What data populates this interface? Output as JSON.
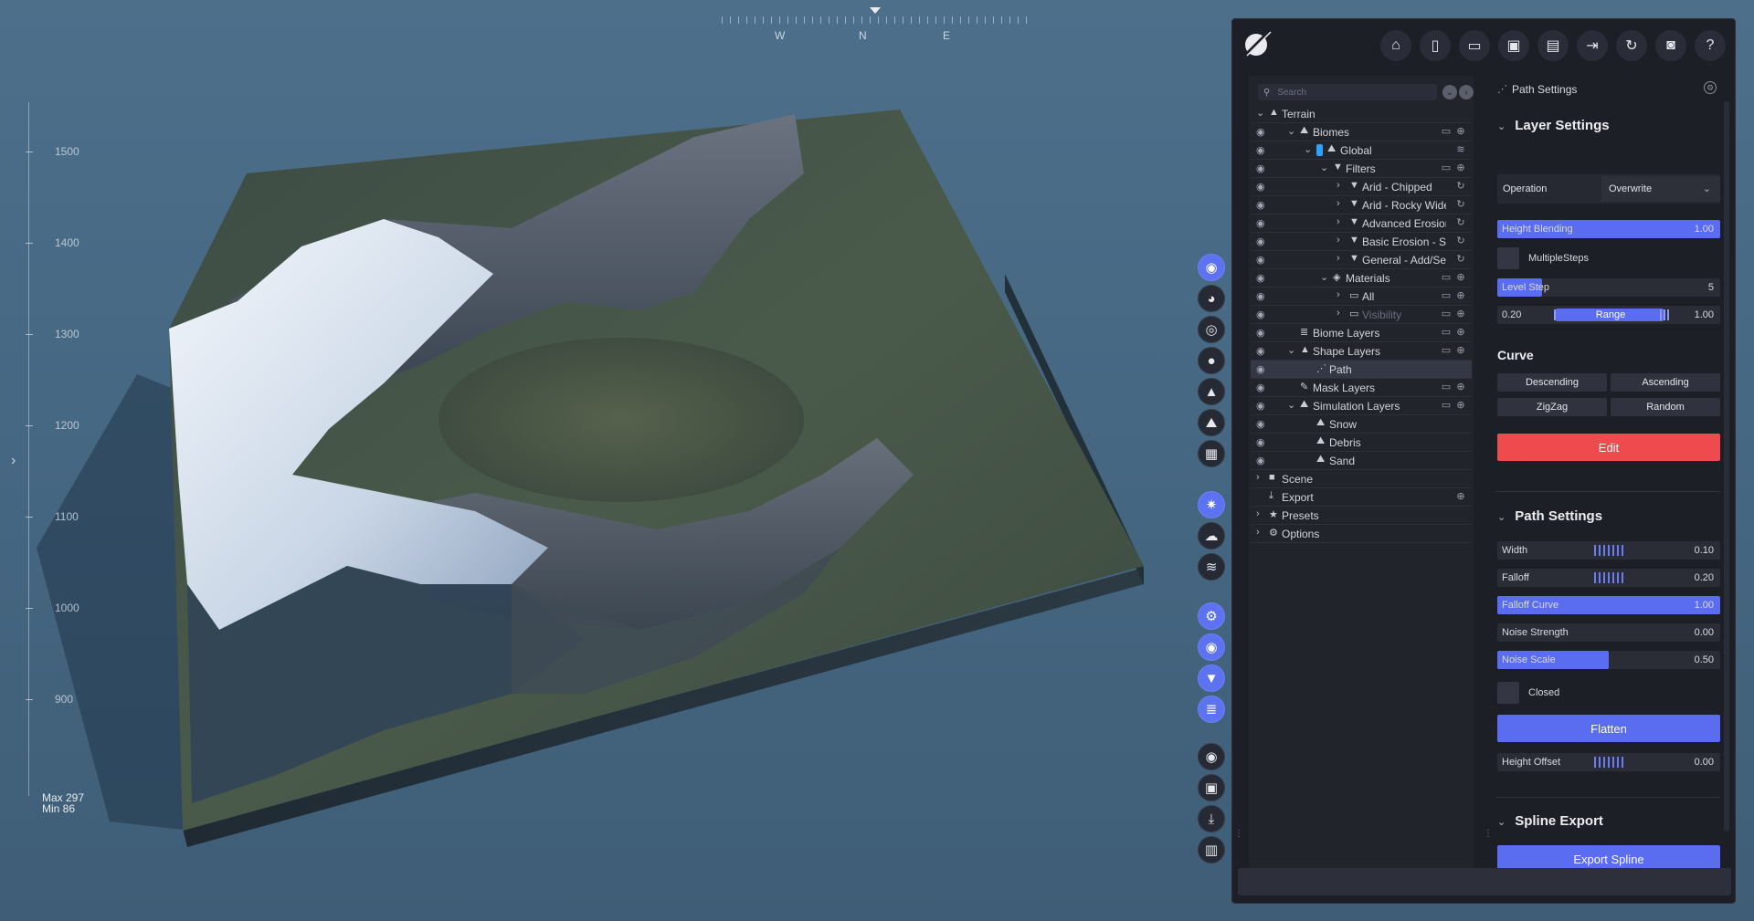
{
  "compass": {
    "west": "W",
    "north": "N",
    "east": "E"
  },
  "ruler": {
    "labels": [
      "1500",
      "1400",
      "1300",
      "1200",
      "1100",
      "1000",
      "900"
    ],
    "max_label": "Max 297",
    "min_label": "Min 86"
  },
  "side_toolbar": {
    "buttons": [
      {
        "icon": "compass-icon",
        "glyph": "◉",
        "active": true
      },
      {
        "icon": "globe-icon",
        "glyph": "◕",
        "active": false
      },
      {
        "icon": "target-icon",
        "glyph": "◎",
        "active": false
      },
      {
        "icon": "drop-icon",
        "glyph": "●",
        "active": false
      },
      {
        "icon": "mountain-icon",
        "glyph": "▲",
        "active": false
      },
      {
        "icon": "terrain-icon",
        "glyph": "⛰",
        "active": false
      },
      {
        "icon": "grid-icon",
        "glyph": "▦",
        "active": false
      },
      {
        "icon": "sun-icon",
        "glyph": "✷",
        "active": true
      },
      {
        "icon": "cloud-icon",
        "glyph": "☁",
        "active": false
      },
      {
        "icon": "layers-lines-icon",
        "glyph": "≋",
        "active": false
      },
      {
        "icon": "settings-cogs-icon",
        "glyph": "⚙",
        "active": true
      },
      {
        "icon": "eye-icon",
        "glyph": "◉",
        "active": true
      },
      {
        "icon": "filter-icon",
        "glyph": "▼",
        "active": true
      },
      {
        "icon": "stack-icon",
        "glyph": "≣",
        "active": true
      },
      {
        "icon": "record-icon",
        "glyph": "◉",
        "active": false
      },
      {
        "icon": "image-icon",
        "glyph": "▣",
        "active": false
      },
      {
        "icon": "download-icon",
        "glyph": "⤓",
        "active": false
      },
      {
        "icon": "chart-icon",
        "glyph": "▥",
        "active": false
      }
    ]
  },
  "header": {
    "buttons": [
      {
        "icon": "home-icon",
        "glyph": "⌂"
      },
      {
        "icon": "new-file-icon",
        "glyph": "▯"
      },
      {
        "icon": "open-folder-icon",
        "glyph": "▭"
      },
      {
        "icon": "save-icon",
        "glyph": "▣"
      },
      {
        "icon": "save-as-icon",
        "glyph": "▤"
      },
      {
        "icon": "export-icon",
        "glyph": "⇥"
      },
      {
        "icon": "refresh-icon",
        "glyph": "↻"
      },
      {
        "icon": "camera-icon",
        "glyph": "◙"
      },
      {
        "icon": "help-icon",
        "glyph": "?"
      }
    ]
  },
  "search": {
    "placeholder": "Search"
  },
  "tree": [
    {
      "label": "Terrain",
      "level": 0,
      "eye": false,
      "chevron": "down",
      "icon": "▲",
      "actions": []
    },
    {
      "label": "Biomes",
      "level": 1,
      "eye": true,
      "chevron": "down",
      "icon": "⛰",
      "actions": [
        "▭",
        "⊕"
      ]
    },
    {
      "label": "Global",
      "level": 2,
      "eye": true,
      "chevron": "down",
      "icon": "⛰",
      "tag": true,
      "actions": [
        "≋"
      ]
    },
    {
      "label": "Filters",
      "level": 3,
      "eye": true,
      "chevron": "down",
      "icon": "▼",
      "actions": [
        "▭",
        "⊕"
      ]
    },
    {
      "label": "Arid - Chipped",
      "level": 4,
      "eye": true,
      "chevron": "right",
      "icon": "▼",
      "actions": [
        "↻"
      ]
    },
    {
      "label": "Arid - Rocky Wide",
      "level": 4,
      "eye": true,
      "chevron": "right",
      "icon": "▼",
      "actions": [
        "↻"
      ]
    },
    {
      "label": "Advanced Erosion - W",
      "level": 4,
      "eye": true,
      "chevron": "right",
      "icon": "▼",
      "actions": [
        "↻"
      ]
    },
    {
      "label": "Basic Erosion - Soft Fl",
      "level": 4,
      "eye": true,
      "chevron": "right",
      "icon": "▼",
      "actions": [
        "↻"
      ]
    },
    {
      "label": "General - Add/Set",
      "level": 4,
      "eye": true,
      "chevron": "right",
      "icon": "▼",
      "actions": [
        "↻"
      ]
    },
    {
      "label": "Materials",
      "level": 3,
      "eye": true,
      "chevron": "down",
      "icon": "◈",
      "actions": [
        "▭",
        "⊕"
      ]
    },
    {
      "label": "All",
      "level": 4,
      "eye": true,
      "chevron": "right",
      "icon": "▭",
      "actions": [
        "▭",
        "⊕"
      ]
    },
    {
      "label": "Visibility",
      "level": 4,
      "eye": true,
      "chevron": "right",
      "icon": "▭",
      "dim": true,
      "actions": [
        "▭",
        "⊕"
      ]
    },
    {
      "label": "Biome Layers",
      "level": 1,
      "eye": true,
      "chevron": "none",
      "icon": "≣",
      "actions": [
        "▭",
        "⊕"
      ]
    },
    {
      "label": "Shape Layers",
      "level": 1,
      "eye": true,
      "chevron": "down",
      "icon": "▲",
      "actions": [
        "▭",
        "⊕"
      ]
    },
    {
      "label": "Path",
      "level": 2,
      "eye": true,
      "chevron": "none",
      "icon": "⋰",
      "selected": true,
      "actions": []
    },
    {
      "label": "Mask Layers",
      "level": 1,
      "eye": true,
      "chevron": "none",
      "icon": "✎",
      "actions": [
        "▭",
        "⊕"
      ]
    },
    {
      "label": "Simulation Layers",
      "level": 1,
      "eye": true,
      "chevron": "down",
      "icon": "⛰",
      "actions": [
        "▭",
        "⊕"
      ]
    },
    {
      "label": "Snow",
      "level": 2,
      "eye": true,
      "chevron": "none",
      "icon": "⛰",
      "actions": []
    },
    {
      "label": "Debris",
      "level": 2,
      "eye": true,
      "chevron": "none",
      "icon": "⛰",
      "actions": []
    },
    {
      "label": "Sand",
      "level": 2,
      "eye": true,
      "chevron": "none",
      "icon": "⛰",
      "actions": []
    },
    {
      "label": "Scene",
      "level": 0,
      "eye": false,
      "chevron": "right",
      "icon": "■",
      "actions": []
    },
    {
      "label": "Export",
      "level": 0,
      "eye": false,
      "chevron": "none",
      "icon": "⤓",
      "actions": [
        "⊕"
      ]
    },
    {
      "label": "Presets",
      "level": 0,
      "eye": false,
      "chevron": "right",
      "icon": "★",
      "actions": []
    },
    {
      "label": "Options",
      "level": 0,
      "eye": false,
      "chevron": "right",
      "icon": "⚙",
      "actions": []
    }
  ],
  "settings": {
    "panel_title": "Path Settings",
    "layer_settings": {
      "title": "Layer Settings",
      "operation_label": "Operation",
      "operation_value": "Overwrite",
      "height_blending": {
        "label": "Height Blending",
        "value": "1.00",
        "fill": 1.0
      },
      "multiple_steps": "MultipleSteps",
      "level_step": {
        "label": "Level Step",
        "value": "5",
        "fill": 0.2
      },
      "range": {
        "min": "0.20",
        "label": "Range",
        "max": "1.00"
      },
      "curve_title": "Curve",
      "curve_buttons": [
        "Descending",
        "Ascending",
        "ZigZag",
        "Random"
      ],
      "edit_label": "Edit"
    },
    "path_settings": {
      "title": "Path Settings",
      "width": {
        "label": "Width",
        "value": "0.10",
        "fill": 0.0
      },
      "falloff": {
        "label": "Falloff",
        "value": "0.20",
        "fill": 0.0
      },
      "falloff_curve": {
        "label": "Falloff Curve",
        "value": "1.00",
        "fill": 1.0
      },
      "noise_strength": {
        "label": "Noise Strength",
        "value": "0.00",
        "fill": 0.0
      },
      "noise_scale": {
        "label": "Noise Scale",
        "value": "0.50",
        "fill": 0.5
      },
      "closed": "Closed",
      "flatten_label": "Flatten",
      "height_offset": {
        "label": "Height Offset",
        "value": "0.00",
        "fill": 0.0
      }
    },
    "spline_export": {
      "title": "Spline Export",
      "button_label": "Export Spline"
    }
  },
  "colors": {
    "accent": "#5a6cf0",
    "danger": "#ef4a4e",
    "panel": "#1d1f26"
  }
}
